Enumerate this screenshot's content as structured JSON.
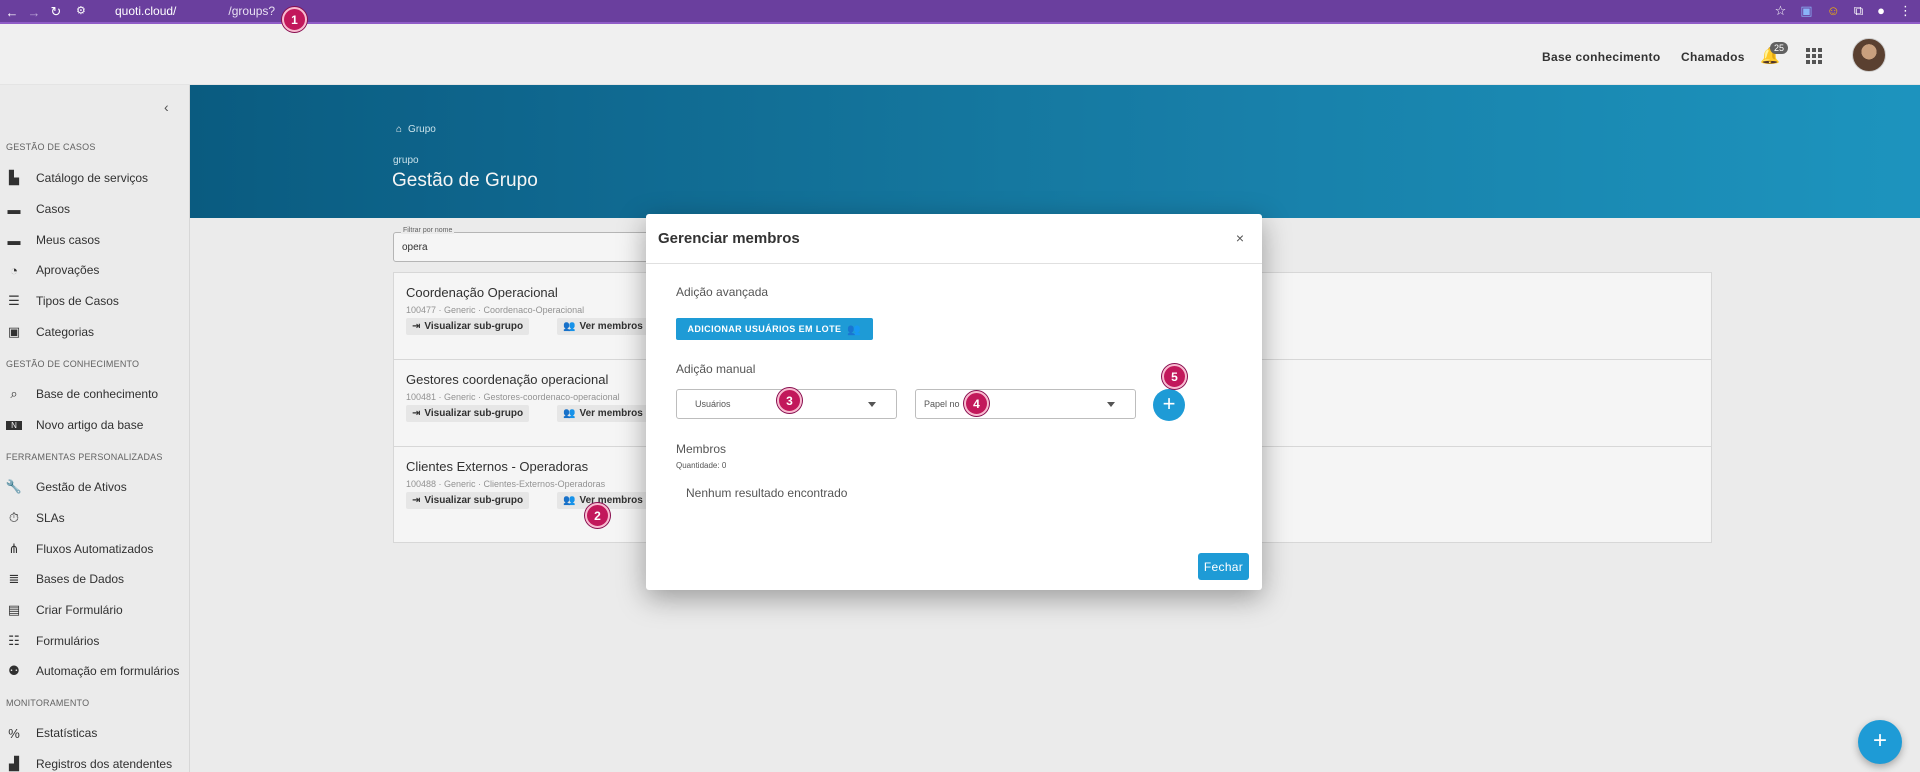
{
  "browser": {
    "domain": "quoti.cloud/",
    "path": "/groups?"
  },
  "header": {
    "links": [
      "Base conhecimento",
      "Chamados"
    ],
    "notification_count": "25"
  },
  "sidebar": {
    "sections": [
      {
        "title": "GESTÃO DE CASOS",
        "items": [
          {
            "label": "Catálogo de serviços",
            "icon": "book-icon"
          },
          {
            "label": "Casos",
            "icon": "ticket-icon"
          },
          {
            "label": "Meus casos",
            "icon": "ticket-person-icon"
          },
          {
            "label": "Aprovações",
            "icon": "approval-icon"
          },
          {
            "label": "Tipos de Casos",
            "icon": "list-icon"
          },
          {
            "label": "Categorias",
            "icon": "category-icon"
          }
        ]
      },
      {
        "title": "GESTÃO DE CONHECIMENTO",
        "items": [
          {
            "label": "Base de conhecimento",
            "icon": "search-icon"
          },
          {
            "label": "Novo artigo da base",
            "icon": "new-badge-icon"
          }
        ]
      },
      {
        "title": "FERRAMENTAS PERSONALIZADAS",
        "items": [
          {
            "label": "Gestão de Ativos",
            "icon": "wrench-icon"
          },
          {
            "label": "SLAs",
            "icon": "timer-icon"
          },
          {
            "label": "Fluxos Automatizados",
            "icon": "flow-icon"
          },
          {
            "label": "Bases de Dados",
            "icon": "database-icon"
          },
          {
            "label": "Criar Formulário",
            "icon": "form-add-icon"
          },
          {
            "label": "Formulários",
            "icon": "checklist-icon"
          },
          {
            "label": "Automação em formulários",
            "icon": "robot-icon"
          }
        ]
      },
      {
        "title": "MONITORAMENTO",
        "items": [
          {
            "label": "Estatísticas",
            "icon": "percent-icon"
          },
          {
            "label": "Registros dos atendentes",
            "icon": "bar-chart-icon"
          }
        ]
      }
    ]
  },
  "banner": {
    "breadcrumb": "Grupo",
    "subtitle": "grupo",
    "title": "Gestão de Grupo"
  },
  "filter": {
    "label": "Filtrar por nome",
    "value": "opera"
  },
  "groups": [
    {
      "name": "Coordenação Operacional",
      "meta": "100477 · Generic · Coordenaco-Operacional",
      "sub_btn": "Visualizar sub-grupo",
      "members_btn": "Ver membros"
    },
    {
      "name": "Gestores coordenação operacional",
      "meta": "100481 · Generic · Gestores-coordenaco-operacional",
      "sub_btn": "Visualizar sub-grupo",
      "members_btn": "Ver membros"
    },
    {
      "name": "Clientes Externos - Operadoras",
      "meta": "100488 · Generic · Clientes-Externos-Operadoras",
      "sub_btn": "Visualizar sub-grupo",
      "members_btn": "Ver membros"
    }
  ],
  "modal": {
    "title": "Gerenciar membros",
    "close_glyph": "×",
    "advanced_title": "Adição avançada",
    "batch_button": "ADICIONAR USUÁRIOS EM LOTE",
    "manual_title": "Adição manual",
    "users_select": "Usuários",
    "role_select": "Papel no",
    "members_title": "Membros",
    "members_count": "Quantidade: 0",
    "empty_text": "Nenhum resultado encontrado",
    "close_button": "Fechar"
  },
  "markers": [
    "1",
    "2",
    "3",
    "4",
    "5"
  ],
  "colors": {
    "browser_bar": "#6a3f9e",
    "banner_start": "#0b5f86",
    "banner_end": "#1f9ac6",
    "primary": "#1e9bd6",
    "marker": "#c2185b"
  }
}
